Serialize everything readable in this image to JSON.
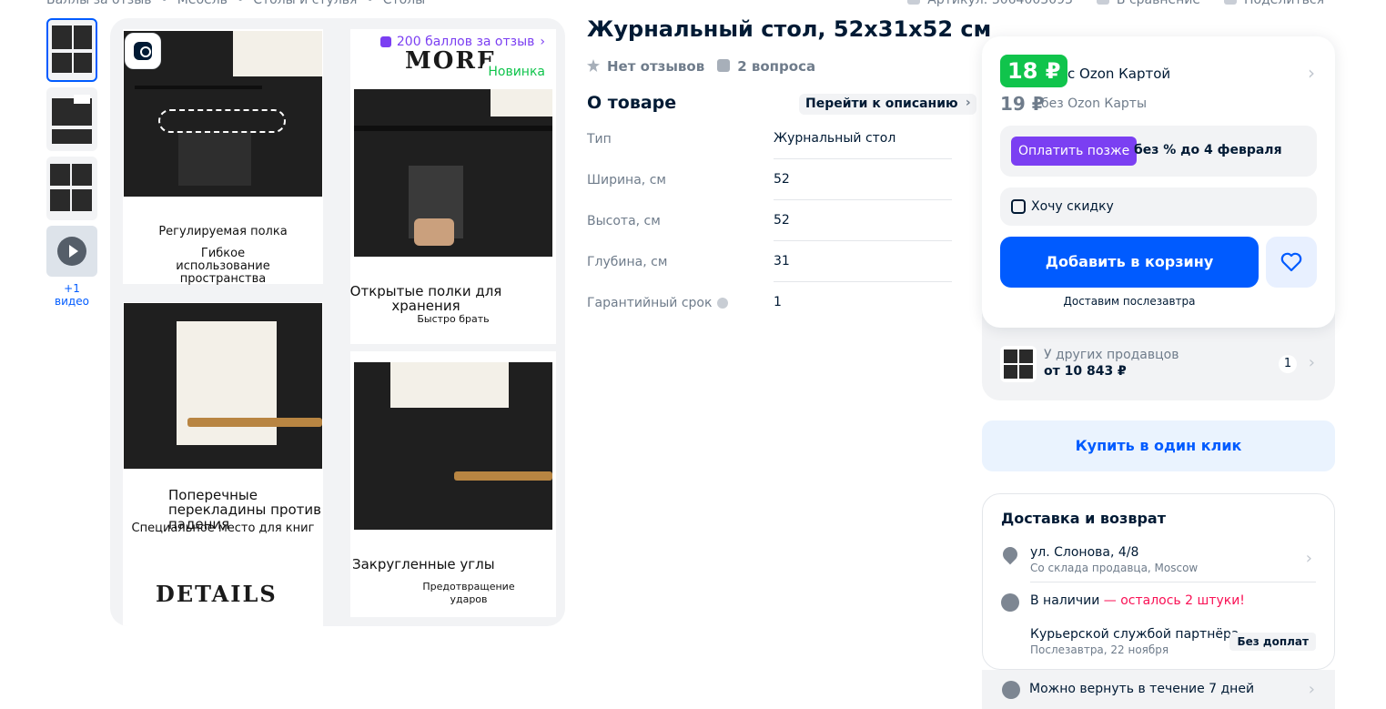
{
  "breadcrumbs": [
    "Баллы за отзыв",
    "Мебель",
    "Столы и стулья",
    "Столы"
  ],
  "top_actions": {
    "article": "Артикул: 3064003093",
    "compare": "В сравнение",
    "share": "Поделиться"
  },
  "thumbnails": {
    "video_label": "+1 видео"
  },
  "gallery": {
    "points_badge": "200 баллов за отзыв",
    "new_badge": "Новинка",
    "wordmark_top": "MORE",
    "wordmark_bottom": "DETAILS",
    "captions": {
      "adjustable_shelf": "Регулируемая полка",
      "flexible_use": "Гибкое использование пространства",
      "open_shelves": "Открытые полки для хранения",
      "quick_take": "Быстро брать",
      "crossbars": "Поперечные перекладины против падения",
      "book_place": "Специальное место для книг",
      "rounded_corners": "Закругленные углы",
      "prevent_bumps": "Предотвращение ударов"
    }
  },
  "product": {
    "title": "Журнальный стол, 52х31х52 см",
    "reviews": "Нет отзывов",
    "questions": "2 вопроса",
    "about_heading": "О товаре",
    "to_description": "Перейти к описанию",
    "specs": [
      {
        "key": "Тип",
        "value": "Журнальный стол"
      },
      {
        "key": "Ширина, см",
        "value": "52"
      },
      {
        "key": "Высота, см",
        "value": "52"
      },
      {
        "key": "Глубина, см",
        "value": "31"
      },
      {
        "key": "Гарантийный срок",
        "value": "1"
      }
    ]
  },
  "buy": {
    "price_card": "18 ₽",
    "price_card_label": "с Ozon Картой",
    "price_regular": "19 ₽",
    "price_regular_label": "без Ozon Карты",
    "pay_later_button": "Оплатить позже",
    "pay_later_text": "без % до 4 февраля",
    "want_discount": "Хочу скидку",
    "add_to_cart": "Добавить в корзину",
    "delivery_note": "Доставим послезавтра",
    "other_sellers": "У других продавцов",
    "other_sellers_price": "от 10 843 ₽",
    "other_sellers_count": "1",
    "one_click": "Купить в один клик"
  },
  "delivery": {
    "heading": "Доставка и возврат",
    "address": "ул. Слонова, 4/8",
    "address_sub": "Со склада продавца, Moscow",
    "stock": "В наличии",
    "stock_warn": "— осталось 2 штуки!",
    "courier": "Курьерской службой партнёра",
    "courier_sub": "Послезавтра, 22 ноября",
    "courier_badge": "Без доплат",
    "returns": "Можно вернуть в течение 7 дней"
  },
  "colors": {
    "accent": "#005bff",
    "price_green": "#10c44c",
    "paylater_purple": "#7b3ff2",
    "warn": "#f91155"
  }
}
